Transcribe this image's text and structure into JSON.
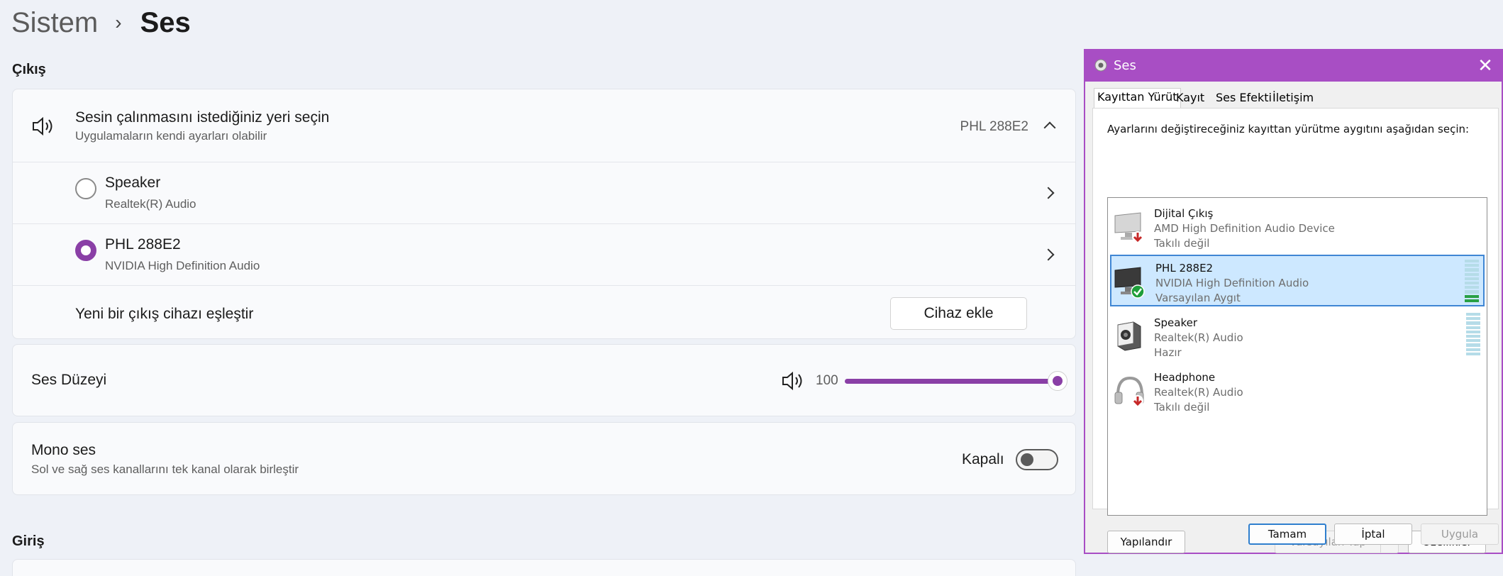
{
  "breadcrumb": {
    "parent": "Sistem",
    "separator": "›",
    "current": "Ses"
  },
  "output": {
    "section_title": "Çıkış",
    "chooser": {
      "title": "Sesin çalınmasını istediğiniz yeri seçin",
      "subtitle": "Uygulamaların kendi ayarları olabilir",
      "selected": "PHL 288E2"
    },
    "devices": [
      {
        "name": "Speaker",
        "desc": "Realtek(R) Audio",
        "selected": false
      },
      {
        "name": "PHL 288E2",
        "desc": "NVIDIA High Definition Audio",
        "selected": true
      }
    ],
    "pair": {
      "label": "Yeni bir çıkış cihazı eşleştir",
      "button": "Cihaz ekle"
    }
  },
  "volume": {
    "label": "Ses Düzeyi",
    "value": "100",
    "level": 1.0
  },
  "mono": {
    "title": "Mono ses",
    "subtitle": "Sol ve sağ ses kanallarını tek kanal olarak birleştir",
    "state": "Kapalı"
  },
  "input": {
    "section_title": "Giriş"
  },
  "dialog": {
    "title": "Ses",
    "tabs": [
      "Kayıttan Yürüt",
      "Kayıt",
      "Ses Efekti",
      "İletişim"
    ],
    "instruction": "Ayarlarını değiştireceğiniz kayıttan yürütme aygıtını aşağıdan seçin:",
    "devices": [
      {
        "name": "Dijital Çıkış",
        "desc": "AMD High Definition Audio Device",
        "status": "Takılı değil"
      },
      {
        "name": "PHL 288E2",
        "desc": "NVIDIA High Definition Audio",
        "status": "Varsayılan Aygıt"
      },
      {
        "name": "Speaker",
        "desc": "Realtek(R) Audio",
        "status": "Hazır"
      },
      {
        "name": "Headphone",
        "desc": "Realtek(R) Audio",
        "status": "Takılı değil"
      }
    ],
    "buttons": {
      "configure": "Yapılandır",
      "set_default": "Varsayılan Yap",
      "properties": "Özellikler",
      "ok": "Tamam",
      "cancel": "İptal",
      "apply": "Uygula"
    }
  },
  "colors": {
    "accent": "#8a3fa6",
    "dialog_title": "#a84ec4",
    "selection": "#cde8ff"
  }
}
